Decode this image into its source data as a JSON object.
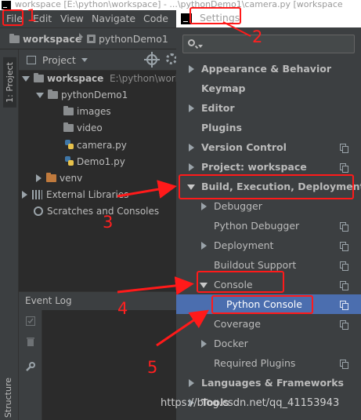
{
  "window": {
    "title": "workspace [E:\\python\\workspace] - ...\\pythonDemo1\\camera.py [workspace"
  },
  "menu": [
    "File",
    "Edit",
    "View",
    "Navigate",
    "Code"
  ],
  "breadcrumb": [
    "workspace",
    "pythonDemo1"
  ],
  "left_stripe": {
    "project_tab": "1: Project",
    "structure_tab": "Structure"
  },
  "project_panel": {
    "title": "Project",
    "tree": [
      {
        "label": "workspace",
        "path": "E:\\python\\works",
        "level": 0,
        "kind": "folder",
        "expanded": true
      },
      {
        "label": "pythonDemo1",
        "level": 1,
        "kind": "folder",
        "expanded": true
      },
      {
        "label": "images",
        "level": 2,
        "kind": "folder"
      },
      {
        "label": "video",
        "level": 2,
        "kind": "folder"
      },
      {
        "label": "camera.py",
        "level": 2,
        "kind": "python"
      },
      {
        "label": "Demo1.py",
        "level": 2,
        "kind": "python"
      },
      {
        "label": "venv",
        "level": 1,
        "kind": "folder-orange",
        "expanded": false
      },
      {
        "label": "External Libraries",
        "level": 0,
        "kind": "libraries",
        "expanded": false
      },
      {
        "label": "Scratches and Consoles",
        "level": 0,
        "kind": "scratches"
      }
    ]
  },
  "event_log": {
    "title": "Event Log"
  },
  "settings": {
    "title": "Settings",
    "search_placeholder": "",
    "items": [
      {
        "label": "Appearance & Behavior",
        "level": 0,
        "bold": true,
        "arrow": "right",
        "copy": false
      },
      {
        "label": "Keymap",
        "level": 0,
        "bold": true,
        "arrow": "none",
        "copy": false
      },
      {
        "label": "Editor",
        "level": 0,
        "bold": true,
        "arrow": "right",
        "copy": false
      },
      {
        "label": "Plugins",
        "level": 0,
        "bold": true,
        "arrow": "none",
        "copy": false
      },
      {
        "label": "Version Control",
        "level": 0,
        "bold": true,
        "arrow": "right",
        "copy": true
      },
      {
        "label": "Project: workspace",
        "level": 0,
        "bold": true,
        "arrow": "right",
        "copy": true
      },
      {
        "label": "Build, Execution, Deployment",
        "level": 0,
        "bold": true,
        "arrow": "down",
        "copy": false
      },
      {
        "label": "Debugger",
        "level": 1,
        "bold": false,
        "arrow": "right",
        "copy": false
      },
      {
        "label": "Python Debugger",
        "level": 1,
        "bold": false,
        "arrow": "none",
        "copy": true
      },
      {
        "label": "Deployment",
        "level": 1,
        "bold": false,
        "arrow": "right",
        "copy": true
      },
      {
        "label": "Buildout Support",
        "level": 1,
        "bold": false,
        "arrow": "none",
        "copy": true
      },
      {
        "label": "Console",
        "level": 1,
        "bold": false,
        "arrow": "down",
        "copy": true
      },
      {
        "label": "Python Console",
        "level": 2,
        "bold": false,
        "arrow": "none",
        "copy": true,
        "selected": true
      },
      {
        "label": "Coverage",
        "level": 1,
        "bold": false,
        "arrow": "none",
        "copy": true
      },
      {
        "label": "Docker",
        "level": 1,
        "bold": false,
        "arrow": "right",
        "copy": false
      },
      {
        "label": "Required Plugins",
        "level": 1,
        "bold": false,
        "arrow": "none",
        "copy": true
      },
      {
        "label": "Languages & Frameworks",
        "level": 0,
        "bold": true,
        "arrow": "right",
        "copy": false
      },
      {
        "label": "Tools",
        "level": 0,
        "bold": true,
        "arrow": "right",
        "copy": false
      }
    ]
  },
  "annotations": {
    "step_numbers": [
      "1",
      "2",
      "3",
      "4",
      "5"
    ],
    "color": "#ff1a1a"
  },
  "watermark": "https://blog.csdn.net/qq_41153943",
  "colors": {
    "ide_background": "#2b2b2b",
    "panel": "#3c3f41",
    "selection": "#4b6eaf"
  }
}
